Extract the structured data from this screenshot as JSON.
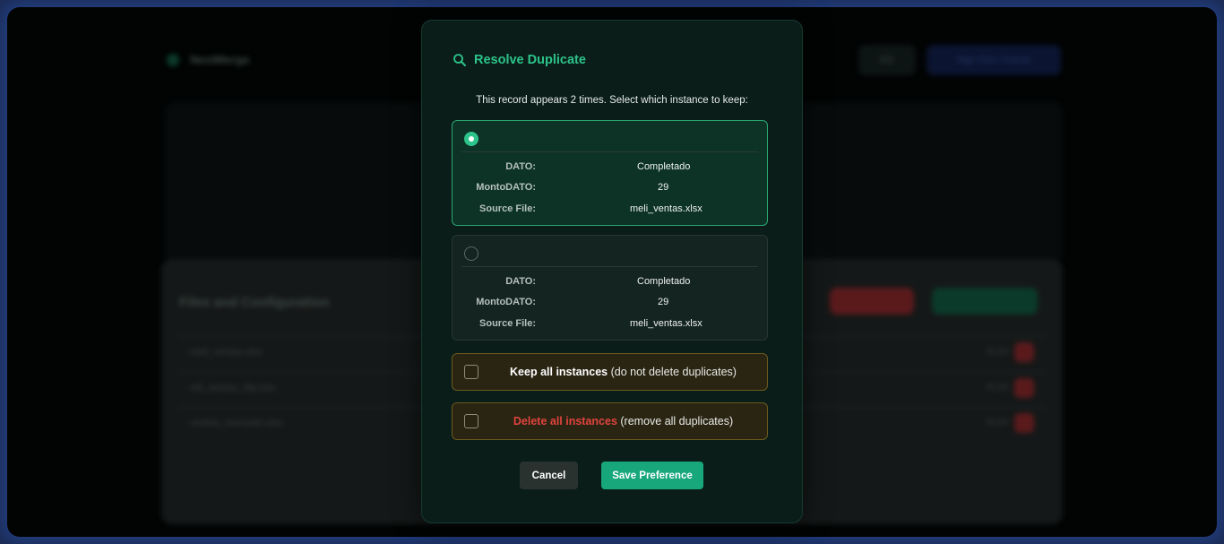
{
  "background": {
    "brand": "NextMerge",
    "lang_label": "ES",
    "signout_label": "Sign Out / Cerrar",
    "card_title": "Files and Configuration",
    "rows": [
      {
        "name": "meli_ventas.xlsx",
        "badge": "XLSX"
      },
      {
        "name": "mli_ventas_obj.xlsx",
        "badge": "XLSX"
      },
      {
        "name": "ventas_mercado.xlsx",
        "badge": "XLSX"
      }
    ]
  },
  "modal": {
    "title": "Resolve Duplicate",
    "description": "This record appears 2 times. Select which instance to keep:",
    "instances": [
      {
        "selected": true,
        "fields": [
          {
            "label": "DATO:",
            "value": "Completado"
          },
          {
            "label": "MontoDATO:",
            "value": "29"
          },
          {
            "label": "Source File:",
            "value": "meli_ventas.xlsx"
          }
        ]
      },
      {
        "selected": false,
        "fields": [
          {
            "label": "DATO:",
            "value": "Completado"
          },
          {
            "label": "MontoDATO:",
            "value": "29"
          },
          {
            "label": "Source File:",
            "value": "meli_ventas.xlsx"
          }
        ]
      }
    ],
    "keep_all": {
      "strong": "Keep all instances",
      "rest": " (do not delete duplicates)"
    },
    "delete_all": {
      "strong": "Delete all instances",
      "rest": " (remove all duplicates)"
    },
    "cancel_label": "Cancel",
    "save_label": "Save Preference"
  },
  "colors": {
    "accent": "#2cc48a",
    "danger": "#e0433e",
    "save_button": "#17a77b"
  }
}
